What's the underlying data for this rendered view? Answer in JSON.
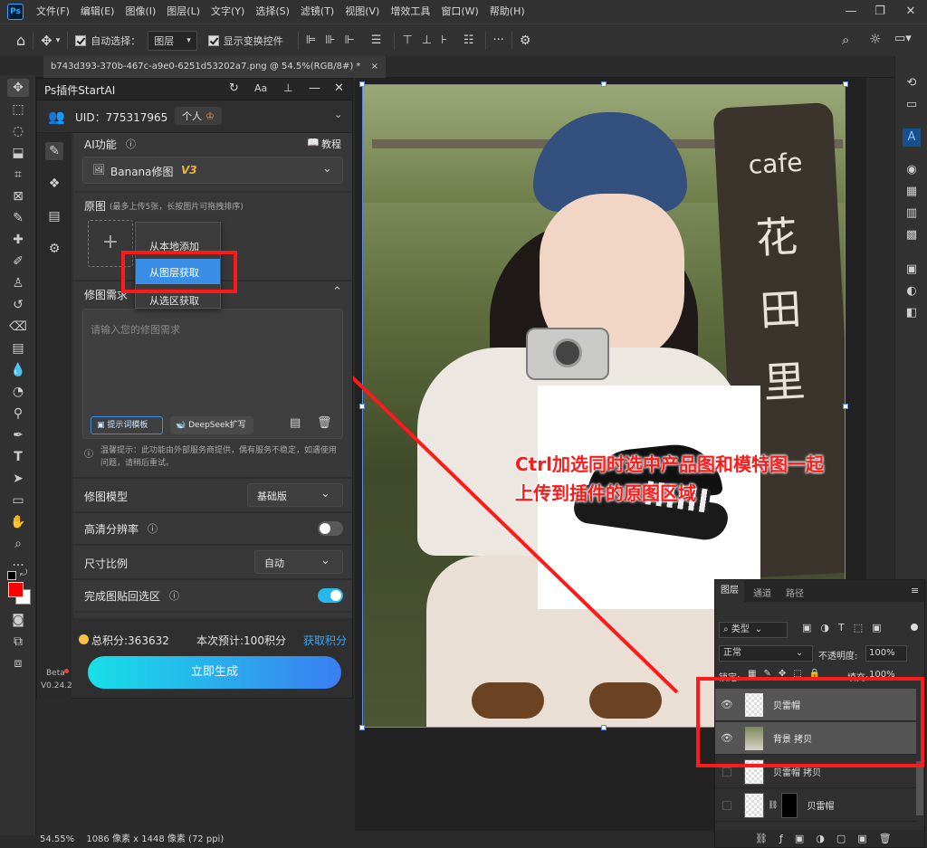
{
  "menubar": {
    "logo": "Ps",
    "items": [
      "文件(F)",
      "编辑(E)",
      "图像(I)",
      "图层(L)",
      "文字(Y)",
      "选择(S)",
      "滤镜(T)",
      "视图(V)",
      "增效工具",
      "窗口(W)",
      "帮助(H)"
    ]
  },
  "options": {
    "auto_select_label": "自动选择：",
    "auto_select_value": "图层",
    "show_transform_label": "显示变换控件",
    "more": "···"
  },
  "document": {
    "tab_title": "b743d393-370b-467c-a9e0-6251d53202a7.png @ 54.5%(RGB/8#) *",
    "close": "×"
  },
  "plugin": {
    "title": "Ps插件StartAI",
    "uid_label": "UID：775317965",
    "user_badge": "个人",
    "ai_function_label": "AI功能",
    "tutorial_label": "教程",
    "function_value": "Banana修图",
    "function_version": "V3",
    "source_label": "原图",
    "source_hint": "(最多上传5张，长按图片可拖拽排序)",
    "menu_items": [
      "从本地添加",
      "从图层获取",
      "从选区获取"
    ],
    "requirement_label": "修图需求",
    "requirement_placeholder": "请输入您的修图需求",
    "prompt_template_btn": "提示词模板",
    "deepseek_btn": "DeepSeek扩写",
    "warning_text": "温馨提示：此功能由外部服务商提供，偶有服务不稳定，如遇使用问题，请稍后重试。",
    "model_label": "修图模型",
    "model_value": "基础版",
    "hd_label": "高清分辨率",
    "ratio_label": "尺寸比例",
    "ratio_value": "自动",
    "paste_back_label": "完成图贴回选区",
    "hd_enabled": false,
    "paste_back_enabled": true,
    "points_text": "总积分:363632",
    "estimate_text": "本次预计:100积分",
    "get_points_link": "获取积分",
    "generate_btn": "立即生成",
    "beta_label": "Beta",
    "version_label": "V0.24.2"
  },
  "annotation": {
    "callout_line1": "Ctrl加选同时选中产品图和模特图一起",
    "callout_line2": "上传到插件的原图区域"
  },
  "photo": {
    "sign_top": "cafe",
    "sign_chars": [
      "花",
      "田",
      "里"
    ]
  },
  "layers": {
    "tabs": [
      "图层",
      "通道",
      "路径"
    ],
    "filter_label": "类型",
    "blend_mode": "正常",
    "opacity_label": "不透明度:",
    "opacity_value": "100%",
    "lock_label": "锁定:",
    "fill_label": "填充:",
    "fill_value": "100%",
    "rows": [
      {
        "name": "贝雷帽",
        "selected": true,
        "visible": true
      },
      {
        "name": "背景 拷贝",
        "selected": true,
        "visible": true
      },
      {
        "name": "贝雷帽 拷贝",
        "selected": false,
        "visible": false
      },
      {
        "name": "贝雷帽",
        "selected": false,
        "visible": false
      }
    ]
  },
  "status": {
    "zoom": "54.55%",
    "dimensions": "1086 像素 x 1448 像素 (72 ppi)"
  },
  "colors": {
    "accent_blue": "#31a8ff",
    "annotation_red": "#ff1a1a",
    "generate_gradient_start": "#17e0e8",
    "generate_gradient_end": "#3a7ef0",
    "foreground_color": "#ff0000",
    "points_coin": "#f5c542"
  }
}
